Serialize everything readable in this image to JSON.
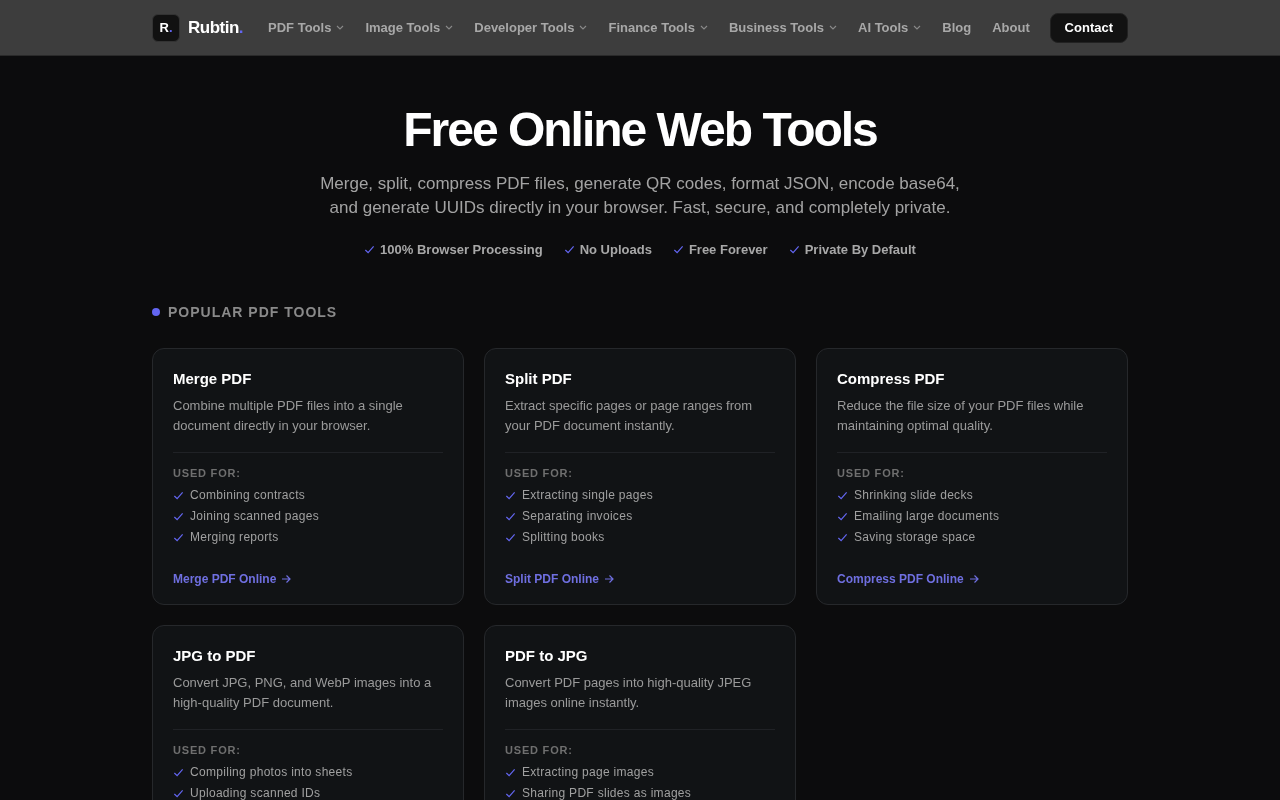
{
  "brand": {
    "mark": "R",
    "mark_dot": ".",
    "name": "Rubtin",
    "name_dot": "."
  },
  "nav": [
    {
      "label": "PDF Tools",
      "dropdown": true
    },
    {
      "label": "Image Tools",
      "dropdown": true
    },
    {
      "label": "Developer Tools",
      "dropdown": true
    },
    {
      "label": "Finance Tools",
      "dropdown": true
    },
    {
      "label": "Business Tools",
      "dropdown": true
    },
    {
      "label": "AI Tools",
      "dropdown": true
    },
    {
      "label": "Blog",
      "dropdown": false
    },
    {
      "label": "About",
      "dropdown": false
    }
  ],
  "contact_button": "Contact",
  "hero": {
    "title": "Free Online Web Tools",
    "subtitle": "Merge, split, compress PDF files, generate QR codes, format JSON, encode base64, and generate UUIDs directly in your browser. Fast, secure, and completely private.",
    "features": [
      "100% Browser Processing",
      "No Uploads",
      "Free Forever",
      "Private By Default"
    ]
  },
  "section": {
    "title": "POPULAR PDF TOOLS",
    "cards": [
      {
        "title": "Merge PDF",
        "description": "Combine multiple PDF files into a single document directly in your browser.",
        "used_for_label": "USED FOR:",
        "uses": [
          "Combining contracts",
          "Joining scanned pages",
          "Merging reports"
        ],
        "link": "Merge PDF Online"
      },
      {
        "title": "Split PDF",
        "description": "Extract specific pages or page ranges from your PDF document instantly.",
        "used_for_label": "USED FOR:",
        "uses": [
          "Extracting single pages",
          "Separating invoices",
          "Splitting books"
        ],
        "link": "Split PDF Online"
      },
      {
        "title": "Compress PDF",
        "description": "Reduce the file size of your PDF files while maintaining optimal quality.",
        "used_for_label": "USED FOR:",
        "uses": [
          "Shrinking slide decks",
          "Emailing large documents",
          "Saving storage space"
        ],
        "link": "Compress PDF Online"
      },
      {
        "title": "JPG to PDF",
        "description": "Convert JPG, PNG, and WebP images into a high-quality PDF document.",
        "used_for_label": "USED FOR:",
        "uses": [
          "Compiling photos into sheets",
          "Uploading scanned IDs"
        ]
      },
      {
        "title": "PDF to JPG",
        "description": "Convert PDF pages into high-quality JPEG images online instantly.",
        "used_for_label": "USED FOR:",
        "uses": [
          "Extracting page images",
          "Sharing PDF slides as images"
        ]
      }
    ]
  }
}
